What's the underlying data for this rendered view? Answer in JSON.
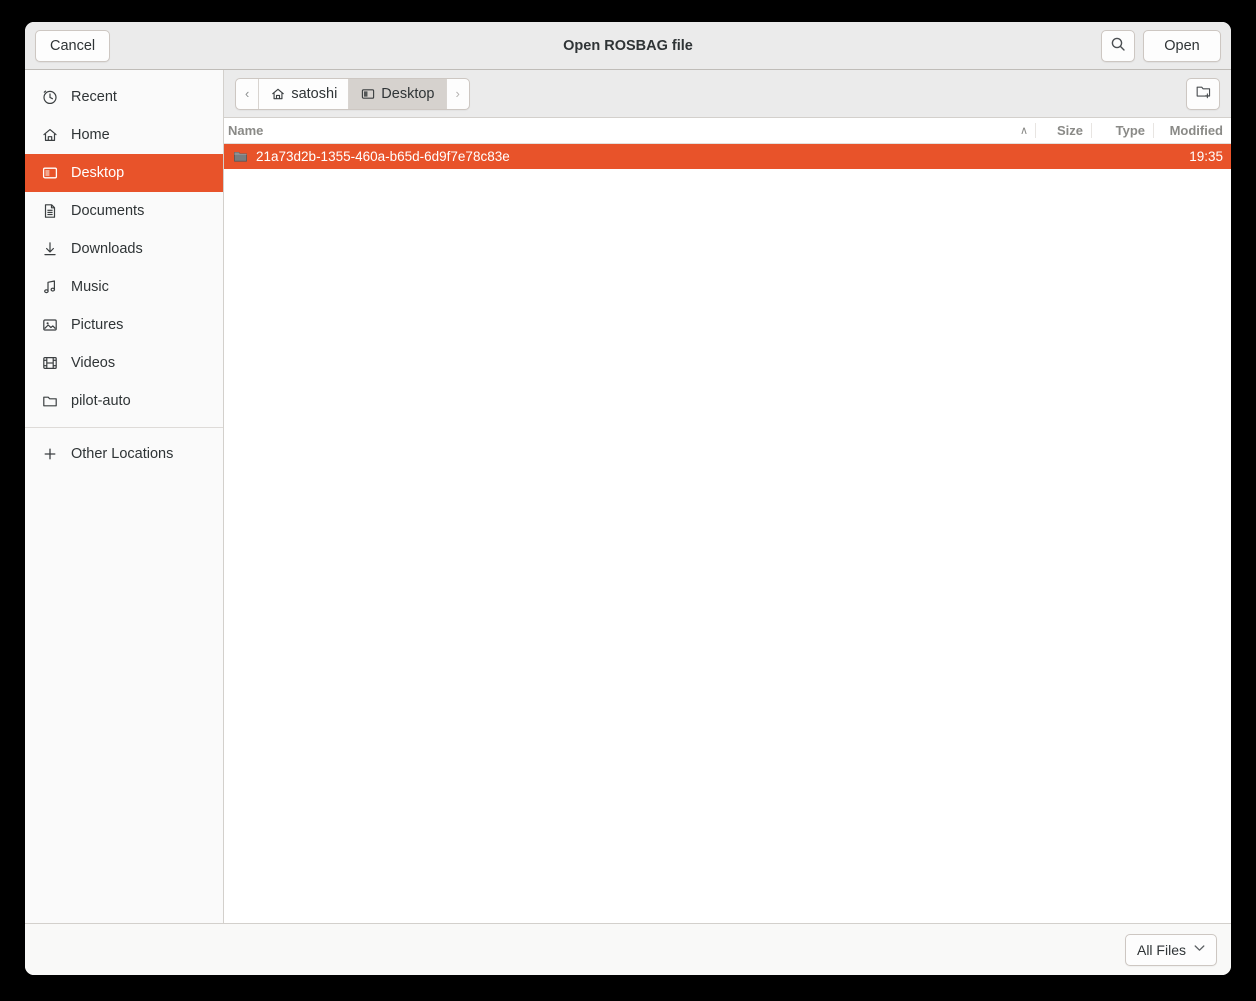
{
  "window": {
    "title": "Open ROSBAG file"
  },
  "header": {
    "cancel_label": "Cancel",
    "open_label": "Open",
    "search_icon": "search-icon"
  },
  "sidebar": {
    "items": [
      {
        "label": "Recent",
        "icon": "clock-icon",
        "selected": false
      },
      {
        "label": "Home",
        "icon": "home-icon",
        "selected": false
      },
      {
        "label": "Desktop",
        "icon": "desktop-icon",
        "selected": true
      },
      {
        "label": "Documents",
        "icon": "document-icon",
        "selected": false
      },
      {
        "label": "Downloads",
        "icon": "download-icon",
        "selected": false
      },
      {
        "label": "Music",
        "icon": "music-icon",
        "selected": false
      },
      {
        "label": "Pictures",
        "icon": "picture-icon",
        "selected": false
      },
      {
        "label": "Videos",
        "icon": "video-icon",
        "selected": false
      },
      {
        "label": "pilot-auto",
        "icon": "folder-icon",
        "selected": false
      }
    ],
    "other_locations": {
      "label": "Other Locations",
      "icon": "plus-icon"
    }
  },
  "pathbar": {
    "back_arrow": "‹",
    "forward_arrow": "›",
    "crumbs": [
      {
        "label": "satoshi",
        "icon": "home-icon",
        "active": false
      },
      {
        "label": "Desktop",
        "icon": "desktop-icon",
        "active": true
      }
    ],
    "new_folder_icon": "new-folder-icon"
  },
  "file_list": {
    "columns": {
      "name": "Name",
      "sort_indicator": "∧",
      "size": "Size",
      "type": "Type",
      "modified": "Modified"
    },
    "rows": [
      {
        "name": "21a73d2b-1355-460a-b65d-6d9f7e78c83e",
        "icon": "folder-icon",
        "size": "",
        "type": "",
        "modified": "19:35",
        "selected": true
      }
    ]
  },
  "footer": {
    "filter_label": "All Files",
    "filter_chevron": "⌄"
  },
  "colors": {
    "accent": "#e8532a",
    "headerbar": "#ebebeb",
    "sidebar": "#fafafa",
    "list_background": "#ffffff",
    "footer": "#f9f9f8",
    "text": "#2f3436",
    "muted_text": "#8a8a87",
    "backdrop": "#000000"
  }
}
